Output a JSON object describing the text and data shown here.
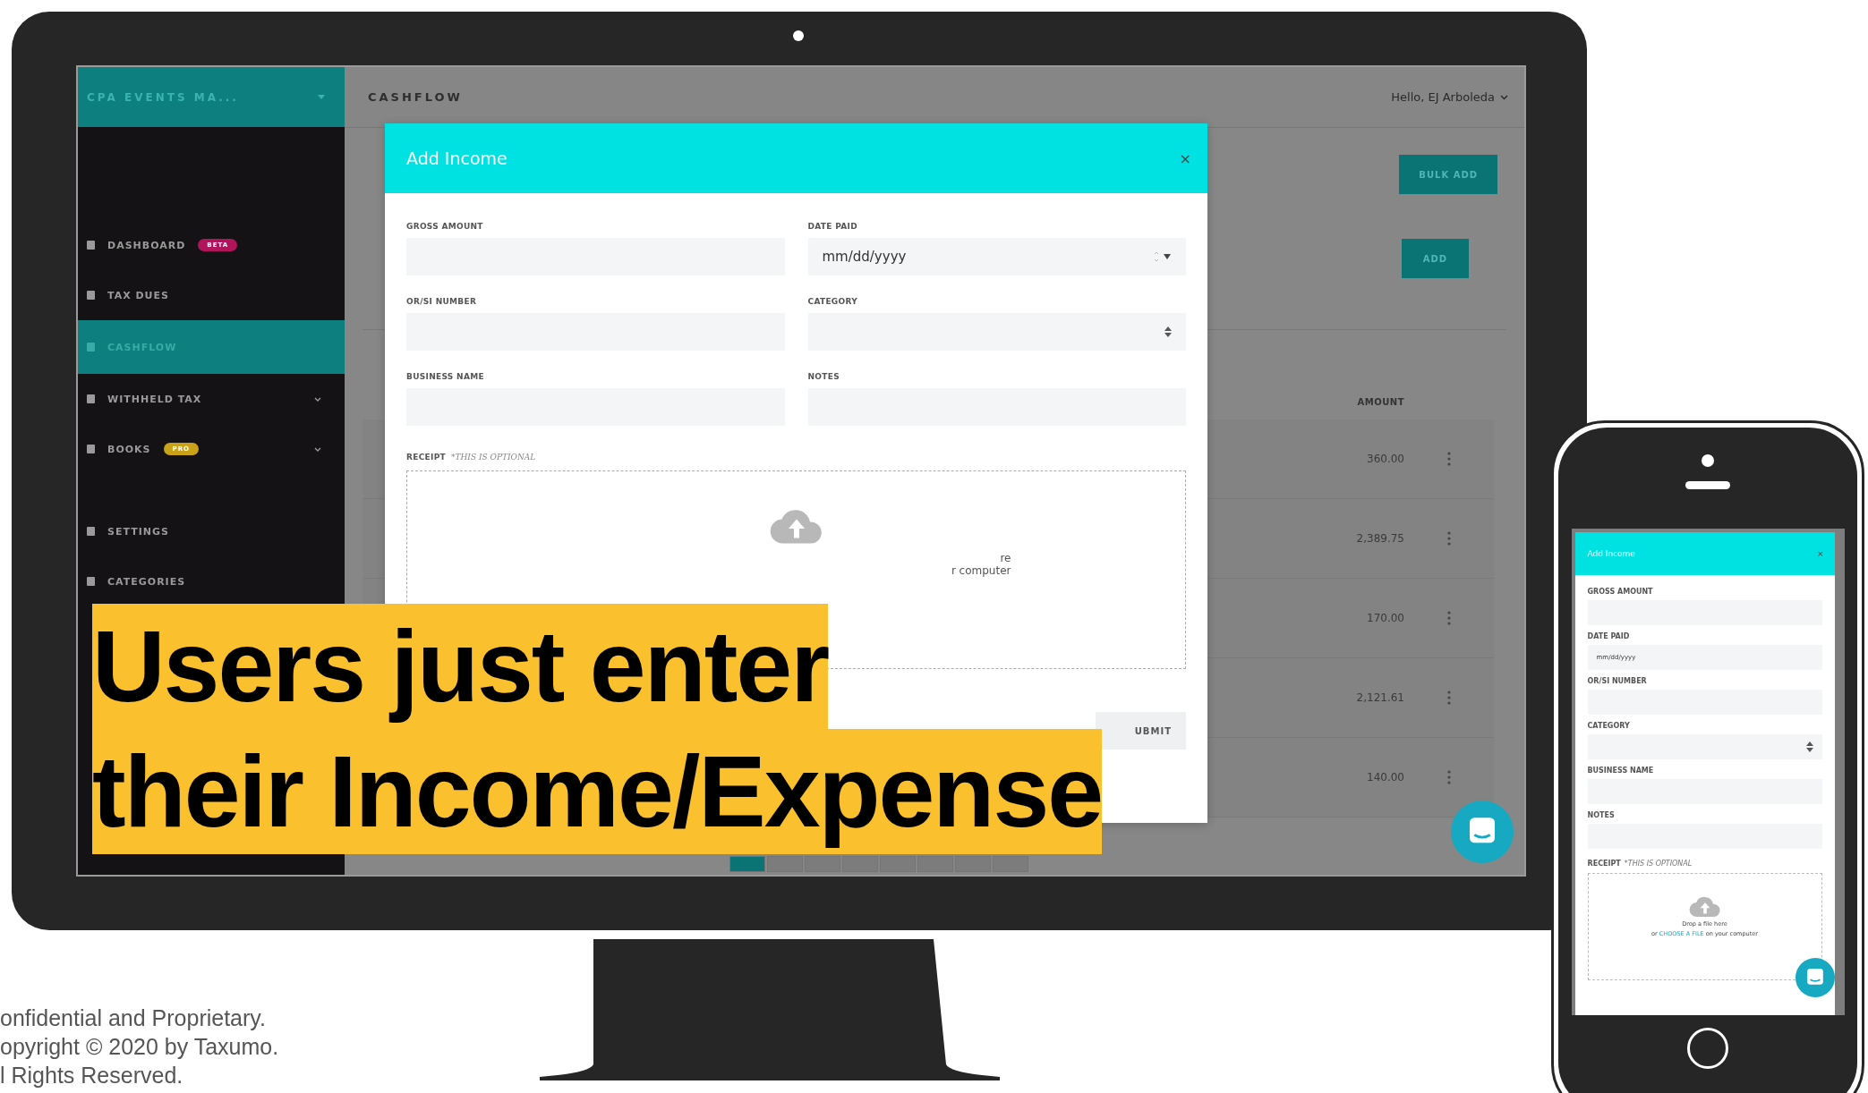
{
  "desktop_app": {
    "sidebar": {
      "org_name": "CPA EVENTS MA...",
      "sections": [
        [
          {
            "label": "DASHBOARD",
            "badge": {
              "text": "BETA",
              "color": "#b0145a"
            },
            "selected": false,
            "expandable": false
          },
          {
            "label": "TAX DUES",
            "selected": false,
            "expandable": false
          },
          {
            "label": "CASHFLOW",
            "selected": true,
            "expandable": false
          },
          {
            "label": "WITHHELD TAX",
            "selected": false,
            "expandable": true
          },
          {
            "label": "BOOKS",
            "badge": {
              "text": "PRO",
              "color": "#c9a21a"
            },
            "selected": false,
            "expandable": true
          }
        ],
        [
          {
            "label": "SETTINGS",
            "selected": false,
            "expandable": false
          },
          {
            "label": "CATEGORIES",
            "selected": false,
            "expandable": false
          }
        ]
      ]
    },
    "topbar": {
      "title": "CASHFLOW",
      "user": "Hello, EJ Arboleda"
    },
    "toolbar": {
      "bulk_add": "BULK ADD",
      "add": "ADD"
    },
    "table": {
      "columns": [
        "AMOUNT"
      ],
      "rows": [
        {
          "amount": "360.00"
        },
        {
          "amount": "2,389.75"
        },
        {
          "amount": "170.00"
        },
        {
          "amount": "2,121.61"
        },
        {
          "amount": "140.00"
        }
      ]
    },
    "modal": {
      "title": "Add Income",
      "close": "×",
      "fields": [
        {
          "label": "GROSS AMOUNT",
          "kind": "text"
        },
        {
          "label": "DATE PAID",
          "kind": "date",
          "placeholder": "mm/dd/yyyy"
        },
        {
          "label": "OR/SI NUMBER",
          "kind": "text"
        },
        {
          "label": "CATEGORY",
          "kind": "select"
        },
        {
          "label": "BUSINESS NAME",
          "kind": "text"
        },
        {
          "label": "NOTES",
          "kind": "text"
        }
      ],
      "receipt": {
        "label": "RECEIPT",
        "note": "*THIS IS OPTIONAL",
        "hint_lines": [
          "re",
          "r computer"
        ]
      },
      "submit": "UBMIT"
    }
  },
  "phone_app": {
    "modal": {
      "title": "Add Income",
      "close": "×",
      "fields": [
        {
          "label": "GROSS AMOUNT",
          "kind": "text"
        },
        {
          "label": "DATE PAID",
          "kind": "date",
          "placeholder": "mm/dd/yyyy"
        },
        {
          "label": "OR/SI NUMBER",
          "kind": "text"
        },
        {
          "label": "CATEGORY",
          "kind": "select"
        },
        {
          "label": "BUSINESS NAME",
          "kind": "text"
        },
        {
          "label": "NOTES",
          "kind": "text"
        }
      ],
      "receipt": {
        "label": "RECEIPT",
        "note": "*THIS IS OPTIONAL",
        "drop_text": "Drop a file here",
        "choose_prefix": "or",
        "choose_link": "CHOOSE A FILE",
        "choose_suffix": "on your computer"
      }
    }
  },
  "caption": {
    "lines": [
      "Users just enter",
      "their Income/Expense"
    ]
  },
  "footer": {
    "lines": [
      "onfidential and Proprietary.",
      "opyright © 2020 by Taxumo.",
      "l Rights Reserved."
    ]
  }
}
